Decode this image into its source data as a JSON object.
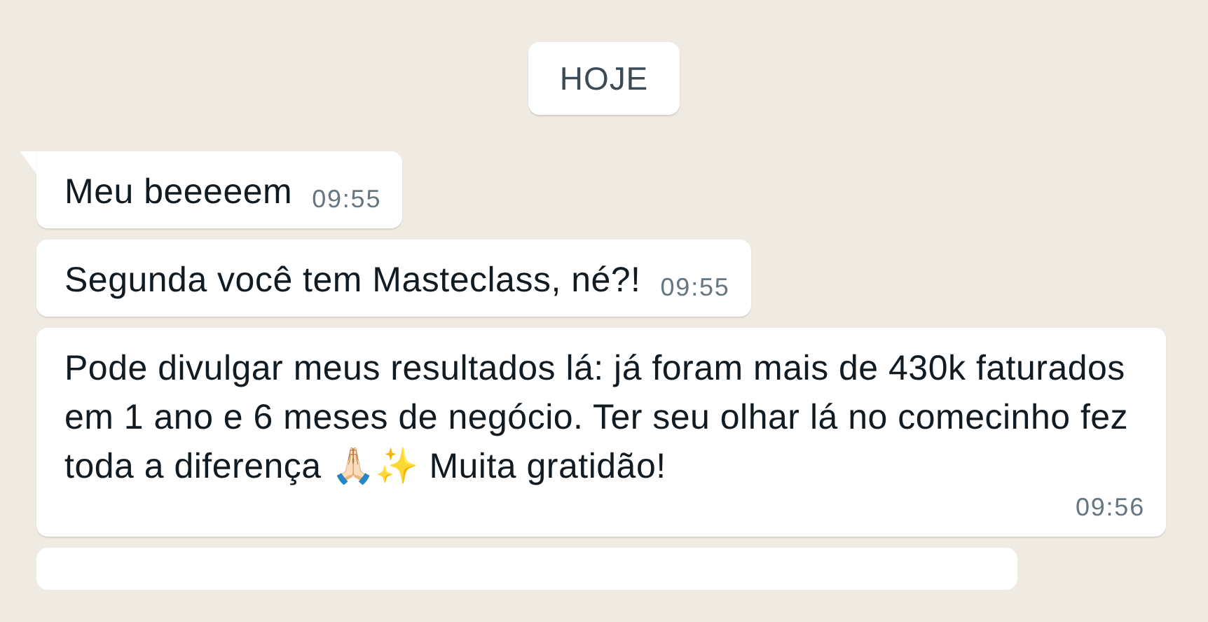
{
  "date_divider": "HOJE",
  "messages": [
    {
      "text": "Meu beeeeem",
      "time": "09:55",
      "tail": true
    },
    {
      "text": "Segunda você tem Masteclass, né?!",
      "time": "09:55",
      "tail": false
    },
    {
      "text": "Pode divulgar meus resultados lá: já foram mais de 430k faturados em 1 ano e 6 meses de negócio. Ter seu olhar lá no comecinho fez toda a diferença 🙏🏻✨ Muita gratidão!",
      "time": "09:56",
      "tail": false
    }
  ]
}
